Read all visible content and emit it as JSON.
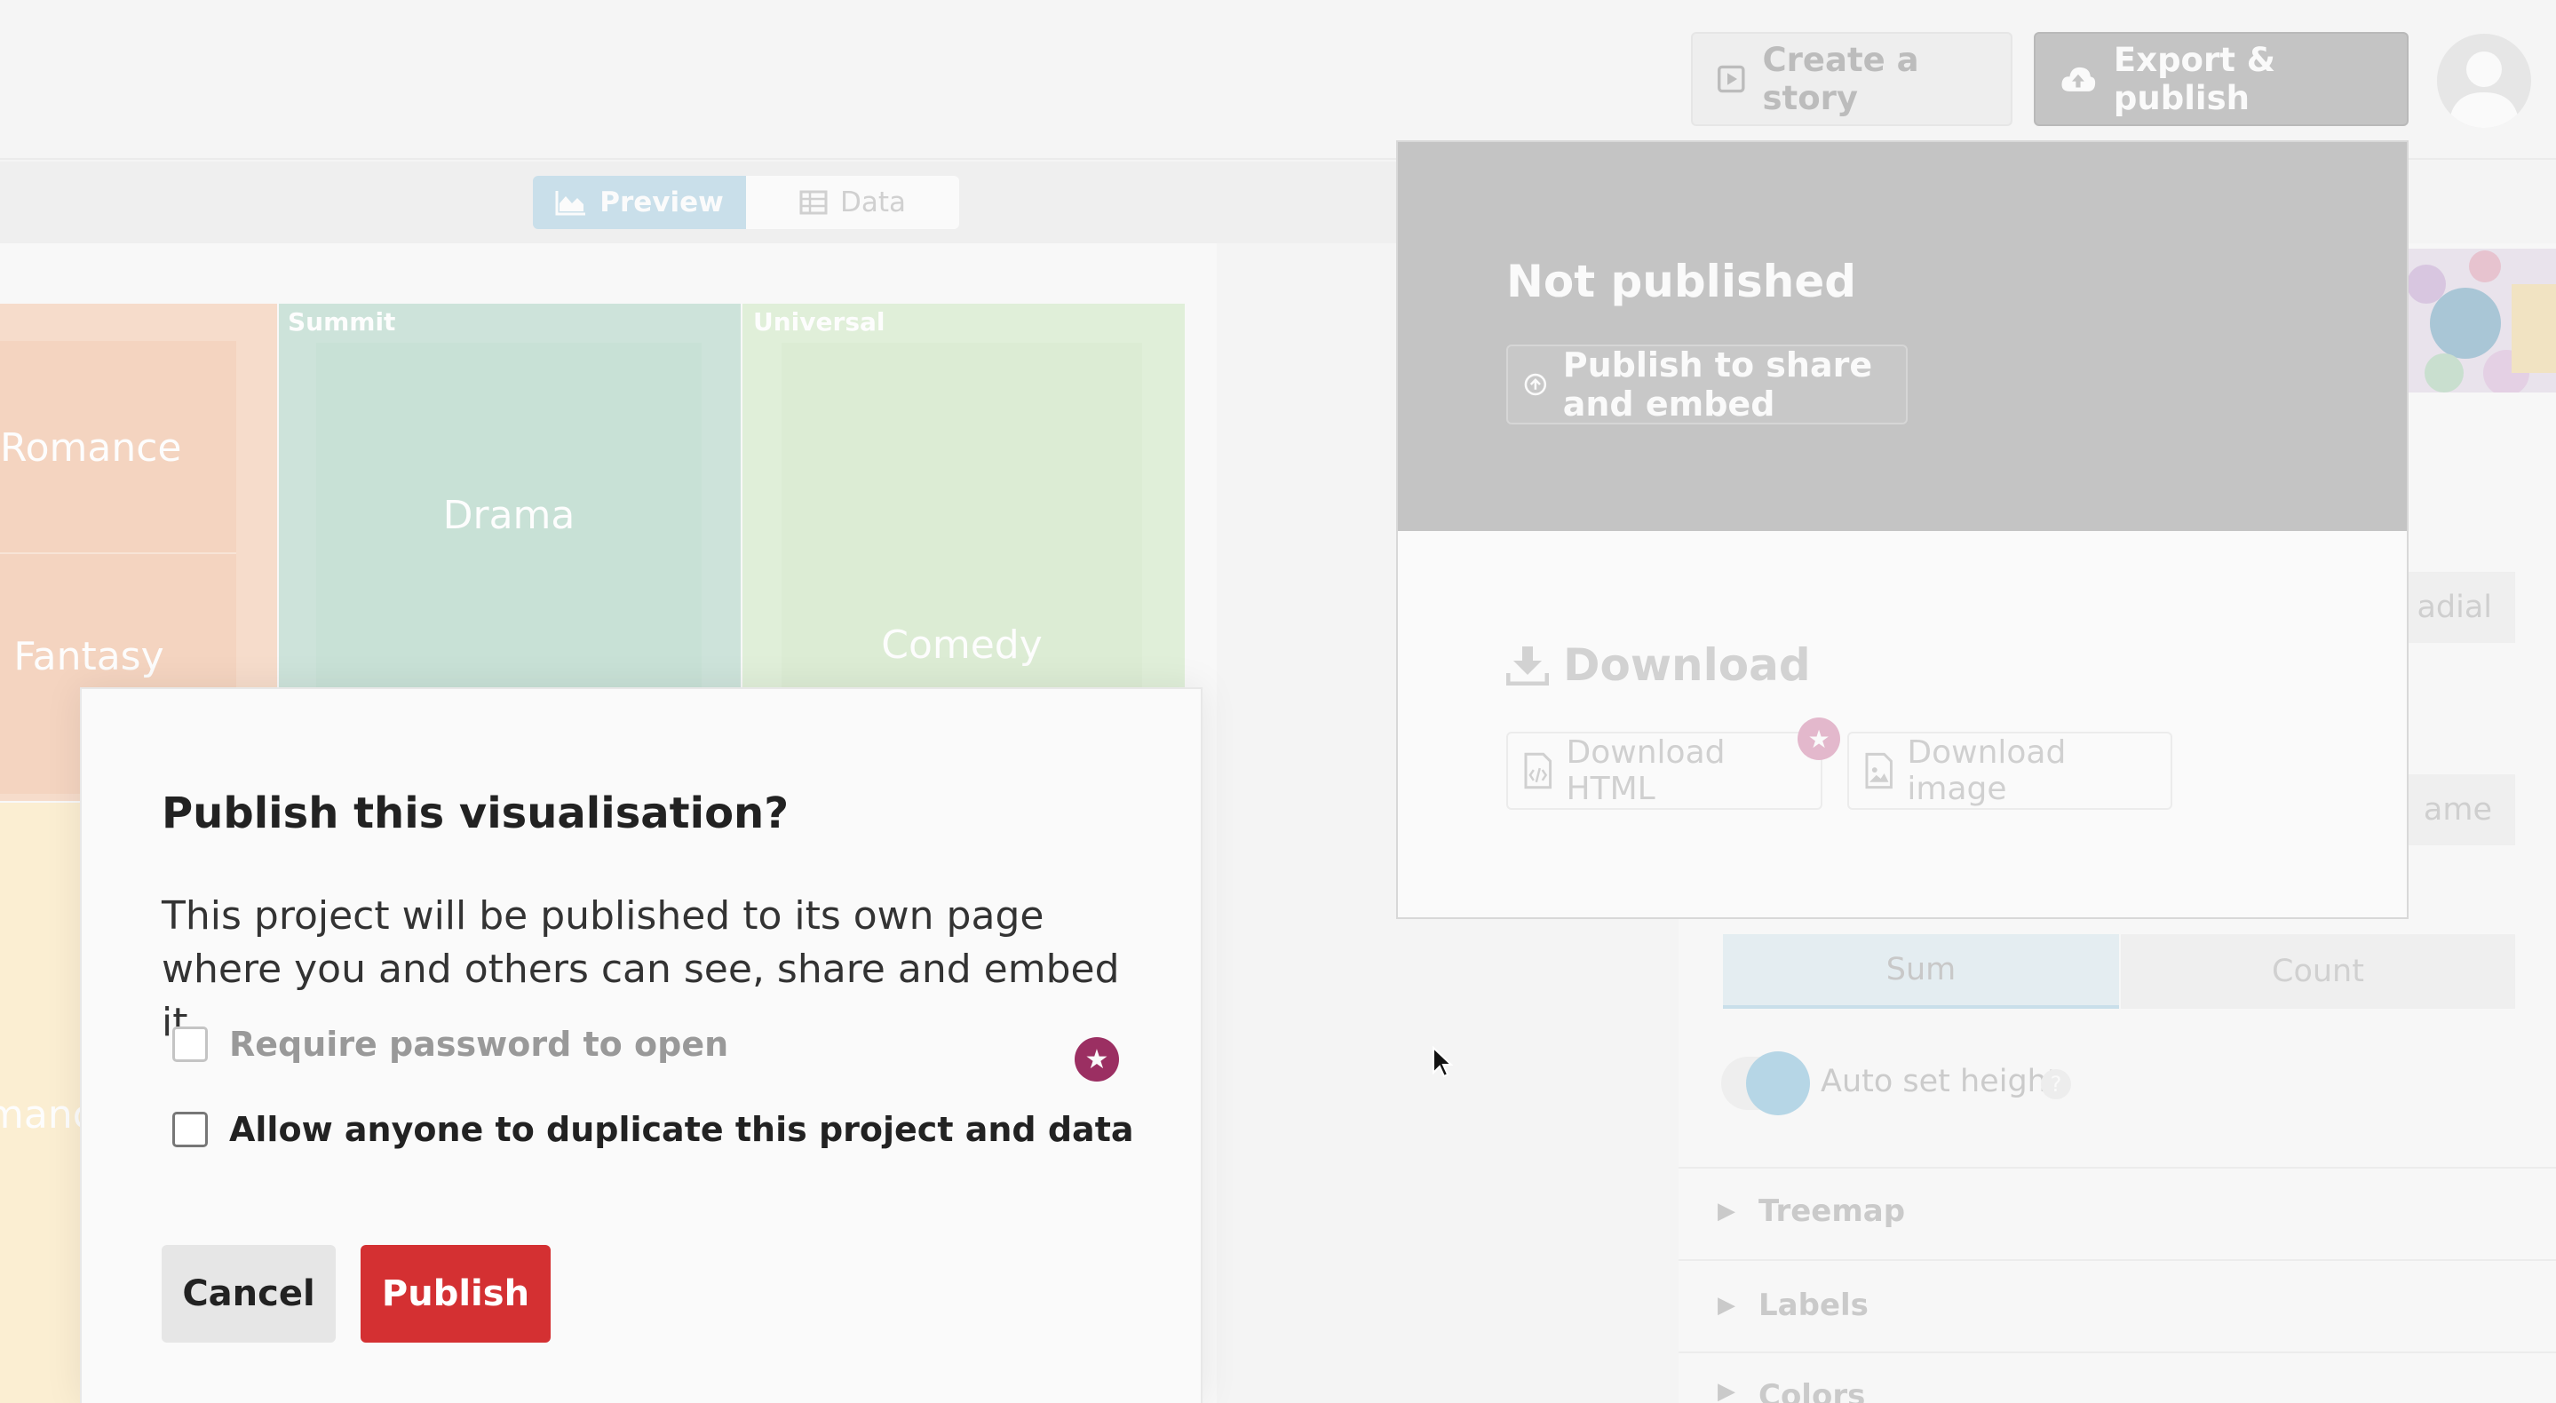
{
  "header": {
    "create_story_label": "Create a story",
    "export_publish_label": "Export & publish"
  },
  "view_toggle": {
    "preview_label": "Preview",
    "data_label": "Data"
  },
  "treemap": {
    "groups": [
      "Summit",
      "Universal"
    ],
    "cells": [
      "Romance",
      "Fantasy",
      "Drama",
      "Comedy",
      "Romance"
    ],
    "colors": {
      "peach": "#f6dccb",
      "green": "#cde3da",
      "light_green": "#e0efd9",
      "cream": "#fbeed2"
    }
  },
  "right_panel": {
    "partial_labels": [
      "adial",
      "ame"
    ],
    "aggregate_options": [
      "Sum",
      "Count"
    ],
    "auto_height_label": "Auto set height",
    "sections": [
      "Treemap",
      "Labels",
      "Colors"
    ]
  },
  "export_dropdown": {
    "status_title": "Not published",
    "publish_button": "Publish to share and embed",
    "download_title": "Download",
    "download_html": "Download HTML",
    "download_image": "Download image"
  },
  "publish_modal": {
    "title": "Publish this visualisation?",
    "description": "This project will be published to its own page where you and others can see, share and embed it",
    "password_option": "Require password to open",
    "duplicate_option": "Allow anyone to duplicate this project and data",
    "cancel_label": "Cancel",
    "publish_label": "Publish",
    "publish_color": "#d43032"
  }
}
